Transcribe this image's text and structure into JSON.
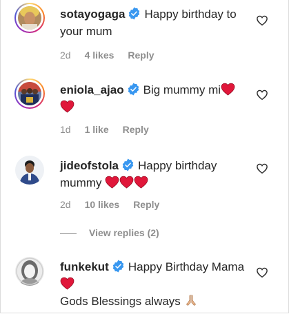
{
  "comments": [
    {
      "username": "sotayogaga",
      "text_line1": "Happy birthday to",
      "text_line2": "your mum",
      "time": "2d",
      "likes": "4 likes",
      "reply": "Reply"
    },
    {
      "username": "eniola_ajao",
      "text_line1": "Big mummy mi",
      "time": "1d",
      "likes": "1 like",
      "reply": "Reply"
    },
    {
      "username": "jideofstola",
      "text_line1": "Happy birthday",
      "text_line2": "mummy",
      "time": "2d",
      "likes": "10 likes",
      "reply": "Reply"
    },
    {
      "username": "funkekut",
      "text_line1": "Happy Birthday Mama",
      "text_line3": "Gods Blessings always"
    }
  ],
  "view_replies": "View replies (2)",
  "colors": {
    "heart": "#e0173a",
    "verified": "#3897f0",
    "meta": "#8e8e8e"
  },
  "icons": [
    "verified-badge-icon",
    "heart-emoji-icon",
    "like-heart-icon",
    "praying-hands-icon"
  ]
}
